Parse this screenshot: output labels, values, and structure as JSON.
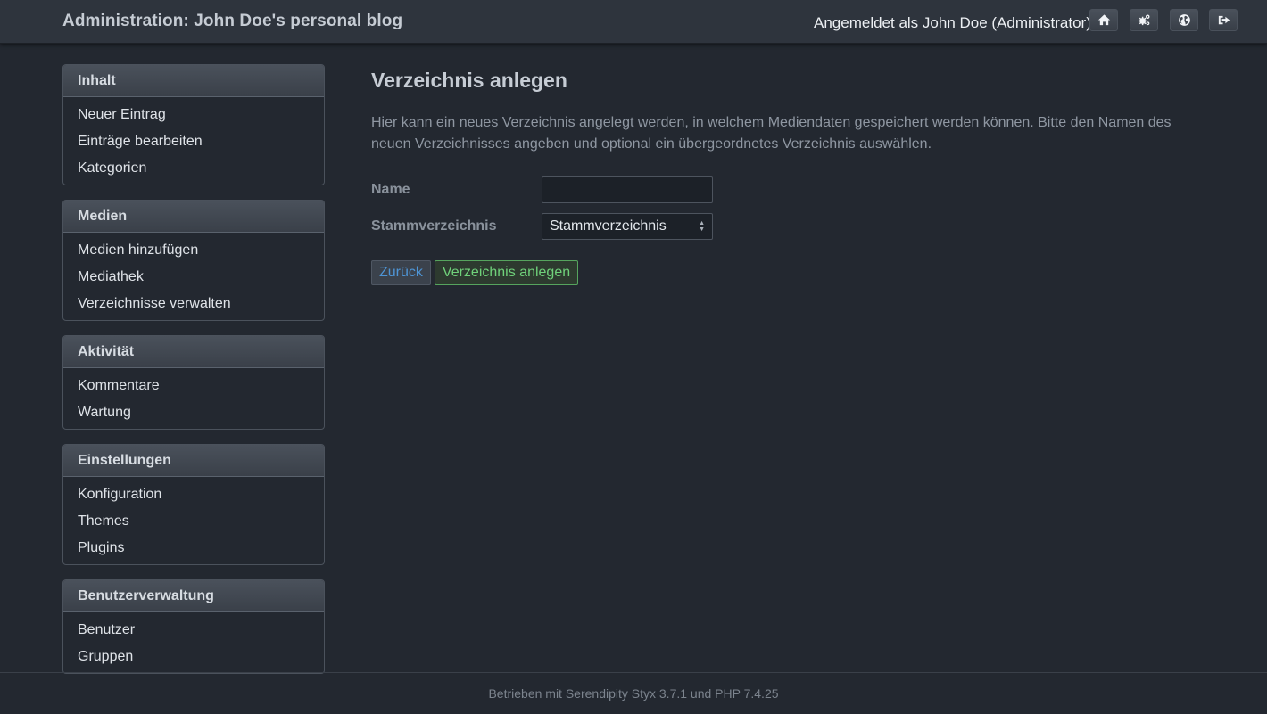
{
  "header": {
    "title": "Administration: John Doe's personal blog",
    "user_status": "Angemeldet als John Doe (Administrator)",
    "icons": [
      "home-icon",
      "cogs-icon",
      "globe-icon",
      "sign-out-icon"
    ]
  },
  "sidebar": {
    "sections": [
      {
        "title": "Inhalt",
        "items": [
          "Neuer Eintrag",
          "Einträge bearbeiten",
          "Kategorien"
        ]
      },
      {
        "title": "Medien",
        "items": [
          "Medien hinzufügen",
          "Mediathek",
          "Verzeichnisse verwalten"
        ]
      },
      {
        "title": "Aktivität",
        "items": [
          "Kommentare",
          "Wartung"
        ]
      },
      {
        "title": "Einstellungen",
        "items": [
          "Konfiguration",
          "Themes",
          "Plugins"
        ]
      },
      {
        "title": "Benutzerverwaltung",
        "items": [
          "Benutzer",
          "Gruppen"
        ]
      }
    ]
  },
  "main": {
    "title": "Verzeichnis anlegen",
    "intro": "Hier kann ein neues Verzeichnis angelegt werden, in welchem Mediendaten gespeichert werden können. Bitte den Namen des neuen Verzeichnisses angeben und optional ein übergeordnetes Verzeichnis auswählen.",
    "form": {
      "name_label": "Name",
      "name_value": "",
      "parent_label": "Stammverzeichnis",
      "parent_selected": "Stammverzeichnis"
    },
    "buttons": {
      "back": "Zurück",
      "create": "Verzeichnis anlegen"
    }
  },
  "footer": {
    "text": "Betrieben mit Serendipity Styx 3.7.1 und PHP 7.4.25"
  },
  "colors": {
    "background": "#232830",
    "topbar": "#2e343d",
    "link_blue": "#4e95d6",
    "success_green": "#6fd07a"
  }
}
